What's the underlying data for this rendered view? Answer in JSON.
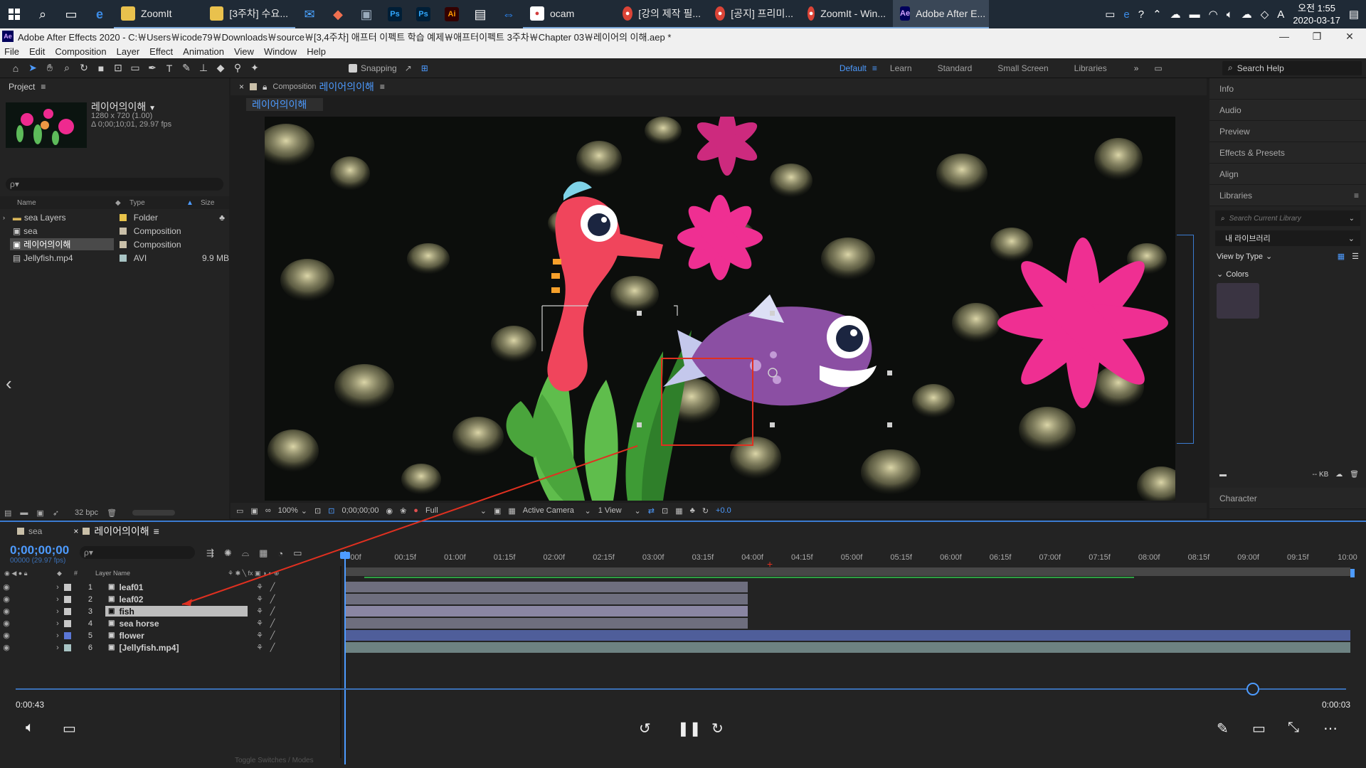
{
  "taskbar": {
    "items": [
      {
        "label": "ZoomIt",
        "icon": "folder-icon",
        "color": "#e9c14d",
        "active": false
      },
      {
        "label": "[3주차] 수요...",
        "icon": "folder-icon",
        "color": "#e9c14d",
        "active": false
      },
      {
        "label": "ocam",
        "icon": "ocam-icon",
        "color": "#d23b3b",
        "active": false
      },
      {
        "label": "[강의 제작 필...",
        "icon": "chrome-icon",
        "color": "#db4437",
        "active": false
      },
      {
        "label": "[공지] 프리미...",
        "icon": "chrome-icon",
        "color": "#db4437",
        "active": false
      },
      {
        "label": "ZoomIt - Win...",
        "icon": "chrome-icon",
        "color": "#db4437",
        "active": false
      },
      {
        "label": "Adobe After E...",
        "icon": "after-effects-icon",
        "color": "#00005b",
        "active": true
      }
    ],
    "app_badges": [
      "Ps",
      "Ps",
      "Ai"
    ],
    "clock_time": "오전 1:55",
    "clock_date": "2020-03-17",
    "ime": "A"
  },
  "window": {
    "title": "Adobe After Effects 2020 - C:￦Users￦icode79￦Downloads￦source￦[3,4주차] 애프터 이펙트 학습 예제￦애프터이펙트 3주차￦Chapter 03￦레이어의 이해.aep *"
  },
  "menu": [
    "File",
    "Edit",
    "Composition",
    "Layer",
    "Effect",
    "Animation",
    "View",
    "Window",
    "Help"
  ],
  "toolbar": {
    "snapping_label": "Snapping",
    "workspaces": [
      "Default",
      "Learn",
      "Standard",
      "Small Screen",
      "Libraries"
    ],
    "active_workspace": "Default",
    "search_help": "Search Help"
  },
  "project": {
    "panel_title": "Project",
    "comp_name": "레이어의이해",
    "comp_size": "1280 x 720 (1.00)",
    "comp_duration": "Δ 0;00;10;01, 29.97 fps",
    "search_placeholder": "ρ▾",
    "columns": {
      "name": "Name",
      "type": "Type",
      "size": "Size"
    },
    "items": [
      {
        "name": "sea Layers",
        "type": "Folder",
        "size": "",
        "color": "#e8c34a",
        "selected": false
      },
      {
        "name": "sea",
        "type": "Composition",
        "size": "",
        "color": "#c9bfa8",
        "selected": false
      },
      {
        "name": "레이어의이해",
        "type": "Composition",
        "size": "",
        "color": "#c9bfa8",
        "selected": true
      },
      {
        "name": "Jellyfish.mp4",
        "type": "AVI",
        "size": "9.9 MB",
        "color": "#a8c4c4",
        "selected": false
      }
    ],
    "bpc": "32 bpc"
  },
  "composition": {
    "tab_prefix": "Composition",
    "tab_name": "레이어의이해",
    "breadcrumb": "레이어의이해",
    "zoom": "100%",
    "timecode": "0;00;00;00",
    "resolution": "Full",
    "camera": "Active Camera",
    "views": "1 View",
    "exposure": "+0.0"
  },
  "right_panel": {
    "items": [
      "Info",
      "Audio",
      "Preview",
      "Effects & Presets",
      "Align"
    ],
    "libraries": "Libraries",
    "lib_search": "Search Current Library",
    "lib_select": "내 라이브러리",
    "view_by": "View by Type",
    "colors": "Colors",
    "kb": "-- KB",
    "character": "Character"
  },
  "timeline": {
    "tabs": [
      "sea",
      "레이어의이해"
    ],
    "timecode": "0;00;00;00",
    "timecode_sub": "00000 (29.97 fps)",
    "layer_name_header": "Layer Name",
    "ruler": [
      "00f",
      "00:15f",
      "01:00f",
      "01:15f",
      "02:00f",
      "02:15f",
      "03:00f",
      "03:15f",
      "04:00f",
      "04:15f",
      "05:00f",
      "05:15f",
      "06:00f",
      "06:15f",
      "07:00f",
      "07:15f",
      "08:00f",
      "08:15f",
      "09:00f",
      "09:15f",
      "10:00"
    ],
    "layers": [
      {
        "num": "1",
        "name": "leaf01",
        "color": "#c8c8c8",
        "selected": false,
        "bar_end": 0.4,
        "bar_color": "#6e6e7e"
      },
      {
        "num": "2",
        "name": "leaf02",
        "color": "#c8c8c8",
        "selected": false,
        "bar_end": 0.4,
        "bar_color": "#6e6e7e"
      },
      {
        "num": "3",
        "name": "fish",
        "color": "#c8c8c8",
        "selected": true,
        "bar_end": 0.4,
        "bar_color": "#8a86a3"
      },
      {
        "num": "4",
        "name": "sea horse",
        "color": "#c8c8c8",
        "selected": false,
        "bar_end": 0.4,
        "bar_color": "#6e6e7e"
      },
      {
        "num": "5",
        "name": "flower",
        "color": "#5b77d6",
        "selected": false,
        "bar_end": 1.0,
        "bar_color": "#4f5e9a"
      },
      {
        "num": "6",
        "name": "[Jellyfish.mp4]",
        "color": "#a8c4c4",
        "selected": false,
        "bar_end": 1.0,
        "bar_color": "#6d8282"
      }
    ],
    "footer": "Toggle Switches / Modes"
  },
  "player": {
    "elapsed": "0:00:43",
    "remaining": "0:00:03",
    "progress": 0.93
  }
}
